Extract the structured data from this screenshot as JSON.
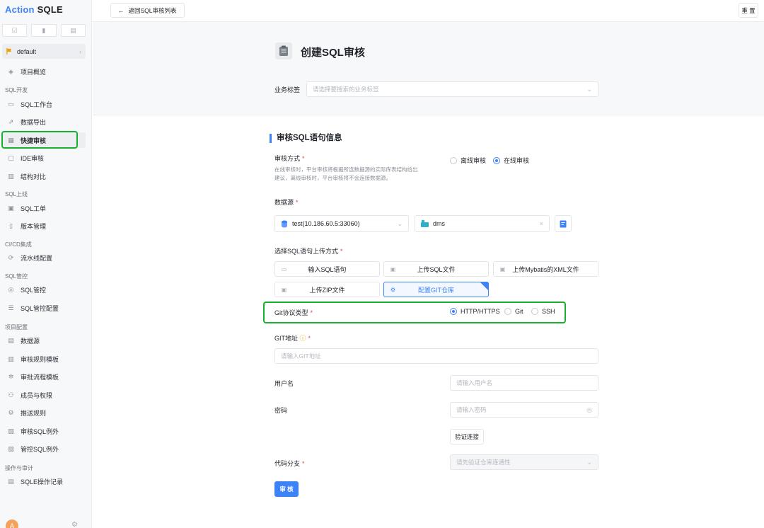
{
  "app": {
    "logo_primary": "Action",
    "logo_secondary": "SQLE"
  },
  "sidebar": {
    "project": "default",
    "overview": "项目概览",
    "groups": {
      "sql_dev": "SQL开发",
      "sql_release": "SQL上线",
      "cicd": "CI/CD集成",
      "sql_control": "SQL管控",
      "project_config": "项目配置",
      "ops_audit": "操作与审计"
    },
    "items": [
      {
        "label": "SQL工作台",
        "icon": "terminal-icon"
      },
      {
        "label": "数据导出",
        "icon": "export-icon"
      },
      {
        "label": "快捷审核",
        "icon": "quick-audit-icon"
      },
      {
        "label": "IDE审核",
        "icon": "ide-icon"
      },
      {
        "label": "结构对比",
        "icon": "compare-icon"
      },
      {
        "label": "SQL工单",
        "icon": "ticket-icon"
      },
      {
        "label": "版本管理",
        "icon": "version-icon"
      },
      {
        "label": "流水线配置",
        "icon": "pipeline-icon"
      },
      {
        "label": "SQL管控",
        "icon": "control-icon"
      },
      {
        "label": "SQL管控配置",
        "icon": "control-config-icon"
      },
      {
        "label": "数据源",
        "icon": "datasource-icon"
      },
      {
        "label": "审核规则模板",
        "icon": "rule-template-icon"
      },
      {
        "label": "审批流程模板",
        "icon": "workflow-icon"
      },
      {
        "label": "成员与权限",
        "icon": "members-icon"
      },
      {
        "label": "推送规则",
        "icon": "push-icon"
      },
      {
        "label": "审核SQL例外",
        "icon": "audit-exception-icon"
      },
      {
        "label": "管控SQL例外",
        "icon": "control-exception-icon"
      },
      {
        "label": "SQLE操作记录",
        "icon": "log-icon"
      }
    ],
    "avatar_letter": "A"
  },
  "header": {
    "back_label": "返回SQL审核列表",
    "reset_label": "重 置"
  },
  "page": {
    "title": "创建SQL审核"
  },
  "form": {
    "tag_label": "业务标签",
    "tag_placeholder": "请选择要搜索的业务标签",
    "section_title": "审核SQL语句信息",
    "audit_mode_label": "审核方式",
    "audit_mode_hint": "在线审核时，平台审核将根据所选数据源的实际库表结构给出建议，离线审核时，平台审核将不会连接数据源。",
    "audit_modes": [
      "离线审核",
      "在线审核"
    ],
    "datasource_label": "数据源",
    "datasource_value": "test(10.186.60.5:33060)",
    "schema_value": "dms",
    "upload_label": "选择SQL语句上传方式",
    "upload_options": [
      "输入SQL语句",
      "上传SQL文件",
      "上传Mybatis的XML文件",
      "上传ZIP文件",
      "配置GIT仓库"
    ],
    "git_protocol_label": "Git协议类型",
    "git_protocols": [
      "HTTP/HTTPS",
      "Git",
      "SSH"
    ],
    "git_url_label": "GIT地址",
    "git_url_placeholder": "请输入GIT地址",
    "username_label": "用户名",
    "username_placeholder": "请输入用户名",
    "password_label": "密码",
    "password_placeholder": "请输入密码",
    "verify_label": "验证连接",
    "branch_label": "代码分支",
    "branch_placeholder": "请先验证仓库连通性",
    "submit_label": "审 核"
  },
  "colors": {
    "primary": "#3e82f7",
    "highlight": "#1aaf2e",
    "required": "#e5484d"
  }
}
